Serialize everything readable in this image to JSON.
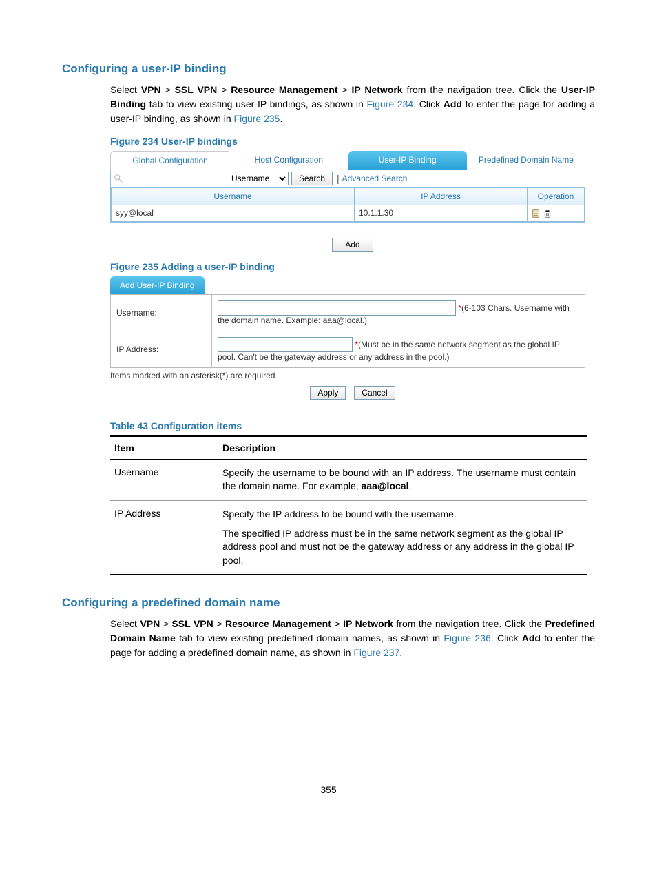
{
  "section1": {
    "heading": "Configuring a user-IP binding",
    "para_parts": {
      "p1a": "Select ",
      "p1b": "VPN",
      "p1c": " > ",
      "p1d": "SSL VPN",
      "p1e": " > ",
      "p1f": "Resource Management",
      "p1g": " > ",
      "p1h": "IP Network",
      "p1i": " from the navigation tree. Click the ",
      "p1j": "User-IP Binding",
      "p1k": " tab to view existing user-IP bindings, as shown in ",
      "p1l": "Figure 234",
      "p1m": ". Click ",
      "p1n": "Add",
      "p1o": " to enter the page for adding a user-IP binding, as shown in ",
      "p1p": "Figure 235",
      "p1q": "."
    }
  },
  "figure234": {
    "caption": "Figure 234 User-IP bindings",
    "tabs": [
      "Global Configuration",
      "Host Configuration",
      "User-IP Binding",
      "Predefined Domain Name"
    ],
    "active_tab_index": 2,
    "search": {
      "field_options": [
        "Username"
      ],
      "selected": "Username",
      "search_btn": "Search",
      "advanced": "Advanced Search"
    },
    "table": {
      "headers": [
        "Username",
        "IP Address",
        "Operation"
      ],
      "rows": [
        {
          "username": "syy@local",
          "ip": "10.1.1.30"
        }
      ]
    },
    "add_btn": "Add"
  },
  "figure235": {
    "caption": "Figure 235 Adding a user-IP binding",
    "tab_label": "Add User-IP Binding",
    "rows": {
      "username_label": "Username:",
      "username_hint1": "(6-103 Chars. Username with",
      "username_hint2": "the domain name. Example: aaa@local.)",
      "ip_label": "IP Address:",
      "ip_hint1": "(Must be in the same network segment as the global IP",
      "ip_hint2": "pool. Can't be the gateway address or any address in the pool.)"
    },
    "note": "Items marked with an asterisk(*) are required",
    "apply_btn": "Apply",
    "cancel_btn": "Cancel"
  },
  "table43": {
    "caption": "Table 43 Configuration items",
    "headers": {
      "item": "Item",
      "desc": "Description"
    },
    "rows": [
      {
        "item": "Username",
        "desc_parts": {
          "a": "Specify the username to be bound with an IP address. The username must contain the domain name. For example, ",
          "b": "aaa@local",
          "c": "."
        }
      },
      {
        "item": "IP Address",
        "desc_p1": "Specify the IP address to be bound with the username.",
        "desc_p2": "The specified IP address must be in the same network segment as the global IP address pool and must not be the gateway address or any address in the global IP pool."
      }
    ]
  },
  "section2": {
    "heading": "Configuring a predefined domain name",
    "para_parts": {
      "a": "Select ",
      "b": "VPN",
      "c": " > ",
      "d": "SSL VPN",
      "e": " > ",
      "f": "Resource Management",
      "g": " > ",
      "h": "IP Network",
      "i": " from the navigation tree. Click the ",
      "j": "Predefined Domain Name",
      "k": " tab to view existing predefined domain names, as shown in ",
      "l": "Figure 236",
      "m": ". Click ",
      "n": "Add",
      "o": " to enter the page for adding a predefined domain name, as shown in ",
      "p": "Figure 237",
      "q": "."
    }
  },
  "page_number": "355"
}
